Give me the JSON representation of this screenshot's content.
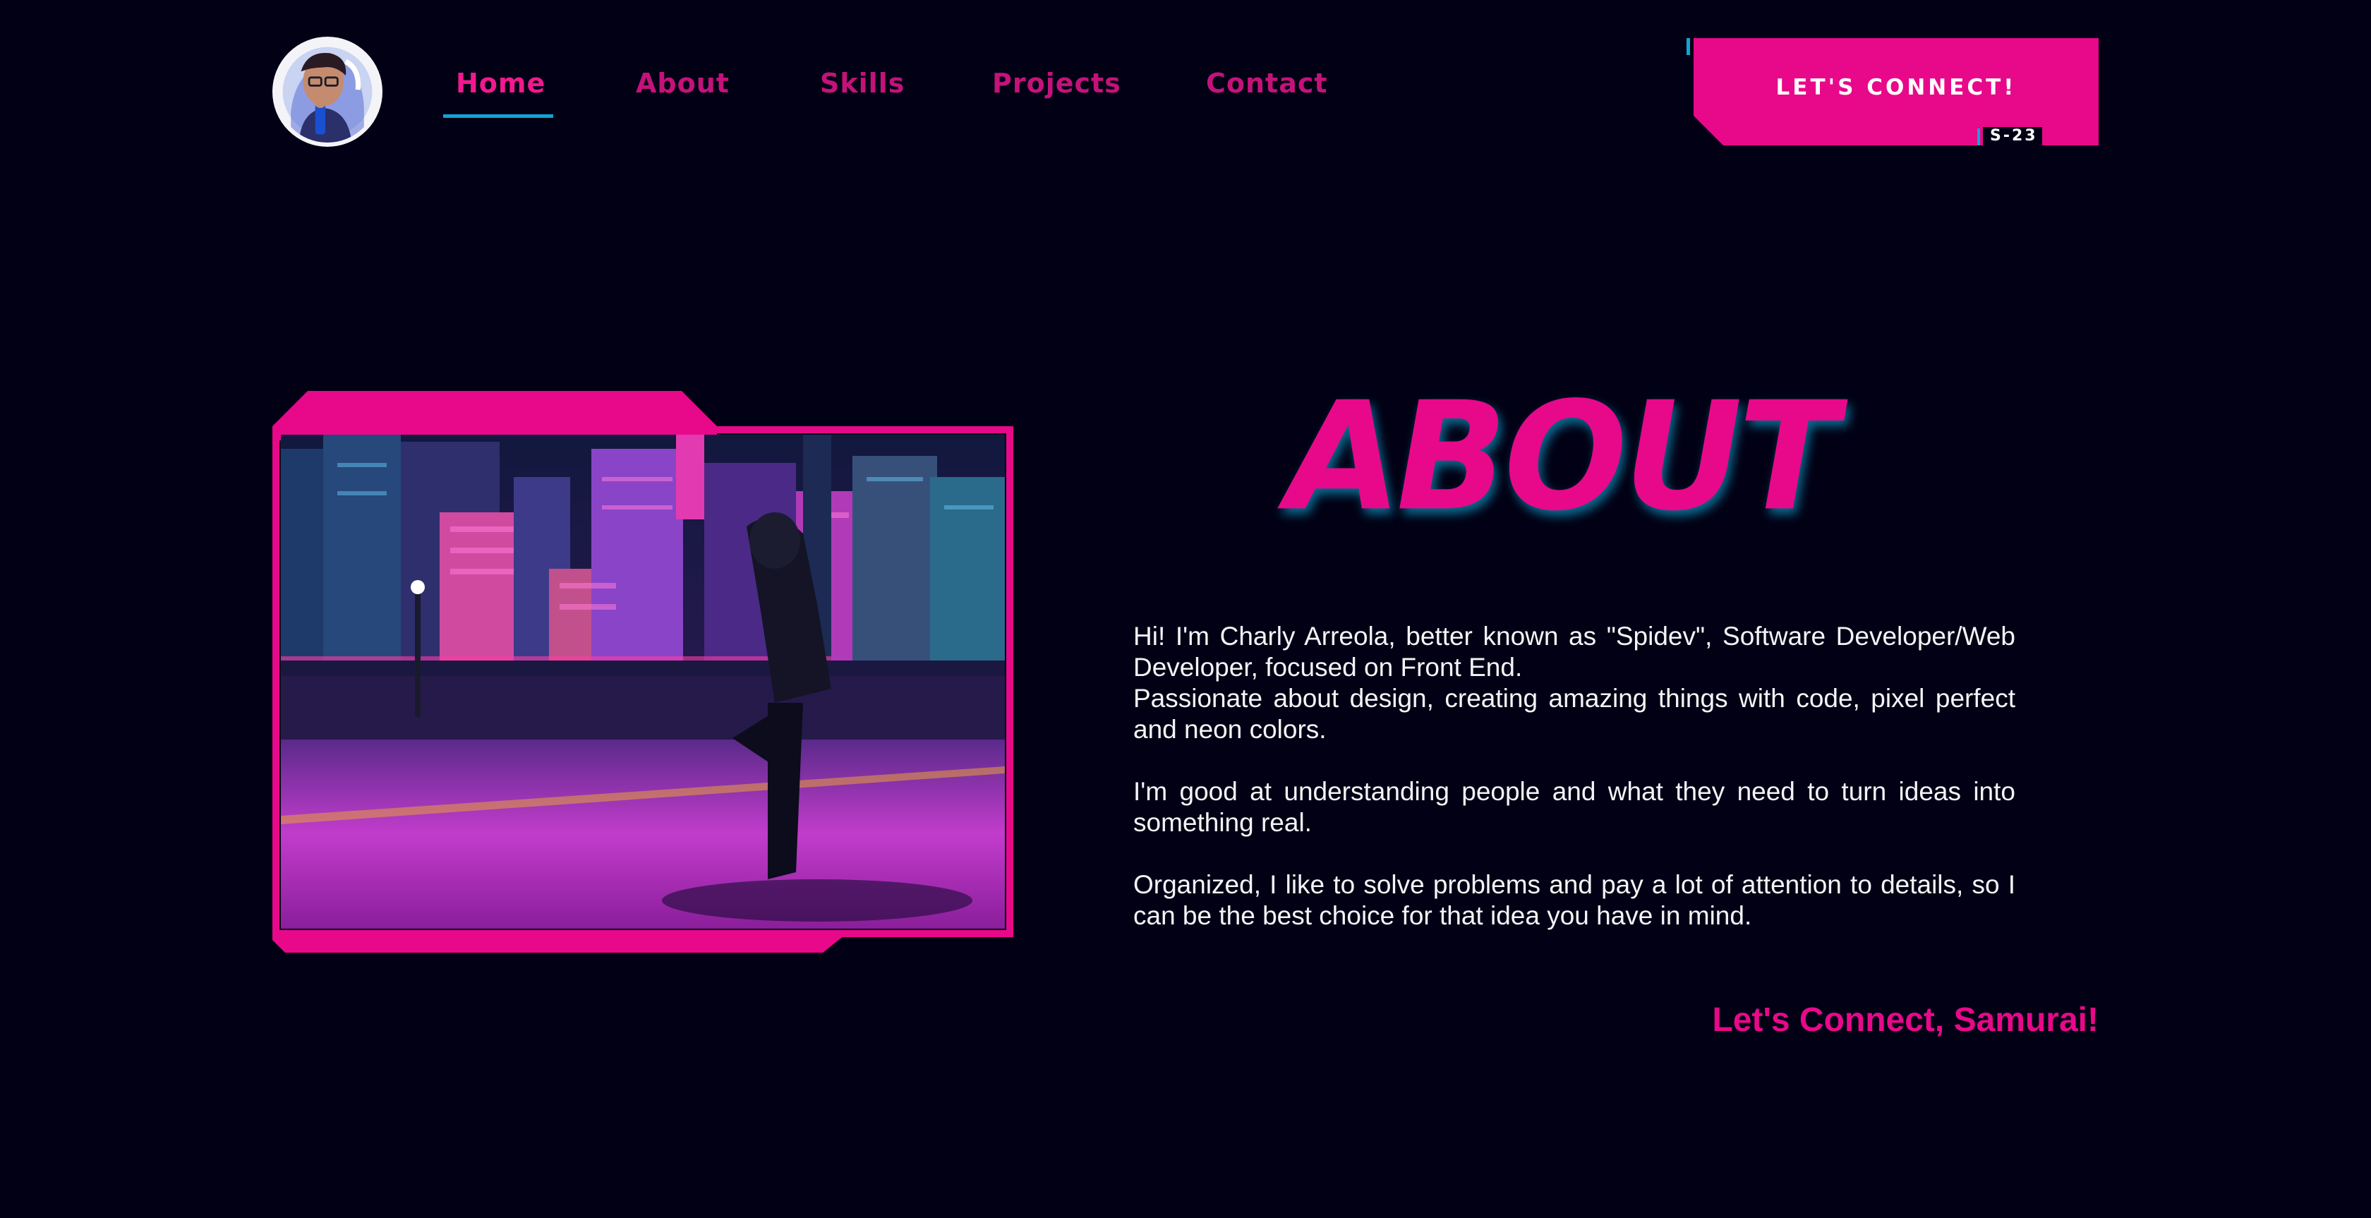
{
  "header": {
    "nav": [
      {
        "label": "Home",
        "active": true
      },
      {
        "label": "About",
        "active": false
      },
      {
        "label": "Skills",
        "active": false
      },
      {
        "label": "Projects",
        "active": false
      },
      {
        "label": "Contact",
        "active": false
      }
    ],
    "cta_label": "LET'S CONNECT!",
    "cta_tag": "S-23"
  },
  "about": {
    "title": "ABOUT",
    "intro_1": "Hi! I'm Charly Arreola, better known as \"Spidev\", Software Developer/Web Developer, focused on Front End.",
    "intro_2": "Passionate about design, creating amazing things with code, pixel perfect and neon colors.",
    "paragraph_2": "I'm good at understanding people and what they need to turn ideas into something real.",
    "paragraph_3": "Organized, I like to solve problems and pay a lot of attention to details, so I can be the best choice for that idea you have in mind.",
    "closing": "Let's Connect, Samurai!"
  },
  "colors": {
    "background": "#020014",
    "accent_pink": "#e8088a",
    "accent_cyan": "#11a4d4",
    "text": "#f4f4f8"
  },
  "icons": {
    "avatar": "profile-avatar",
    "photo": "neon-city-photo"
  }
}
